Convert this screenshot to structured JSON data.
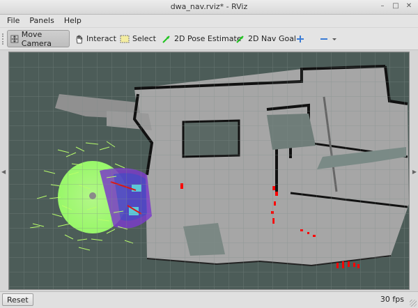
{
  "window": {
    "title": "dwa_nav.rviz* - RViz"
  },
  "menu": {
    "items": [
      "File",
      "Panels",
      "Help"
    ]
  },
  "toolbar": {
    "tools": [
      {
        "label": "Move Camera",
        "icon": "move-camera-icon",
        "active": true
      },
      {
        "label": "Interact",
        "icon": "hand-cursor-icon",
        "active": false
      },
      {
        "label": "Select",
        "icon": "select-box-icon",
        "active": false
      },
      {
        "label": "2D Pose Estimate",
        "icon": "green-arrow-icon",
        "active": false
      },
      {
        "label": "2D Nav Goal",
        "icon": "green-arrow-icon",
        "active": false
      }
    ],
    "add_icon": "plus-icon",
    "remove_icon": "minus-icon"
  },
  "status": {
    "reset_label": "Reset",
    "fps": "30 fps"
  },
  "colors": {
    "unknown_space": "#4c5c58",
    "grid_line": "#7e8c88",
    "free_space": "#a8a8a8",
    "obstacle": "#111111",
    "costmap_green": "#9cff6a",
    "trajectory_purple": "#7a3cc8",
    "laser_red": "#ff0000"
  }
}
